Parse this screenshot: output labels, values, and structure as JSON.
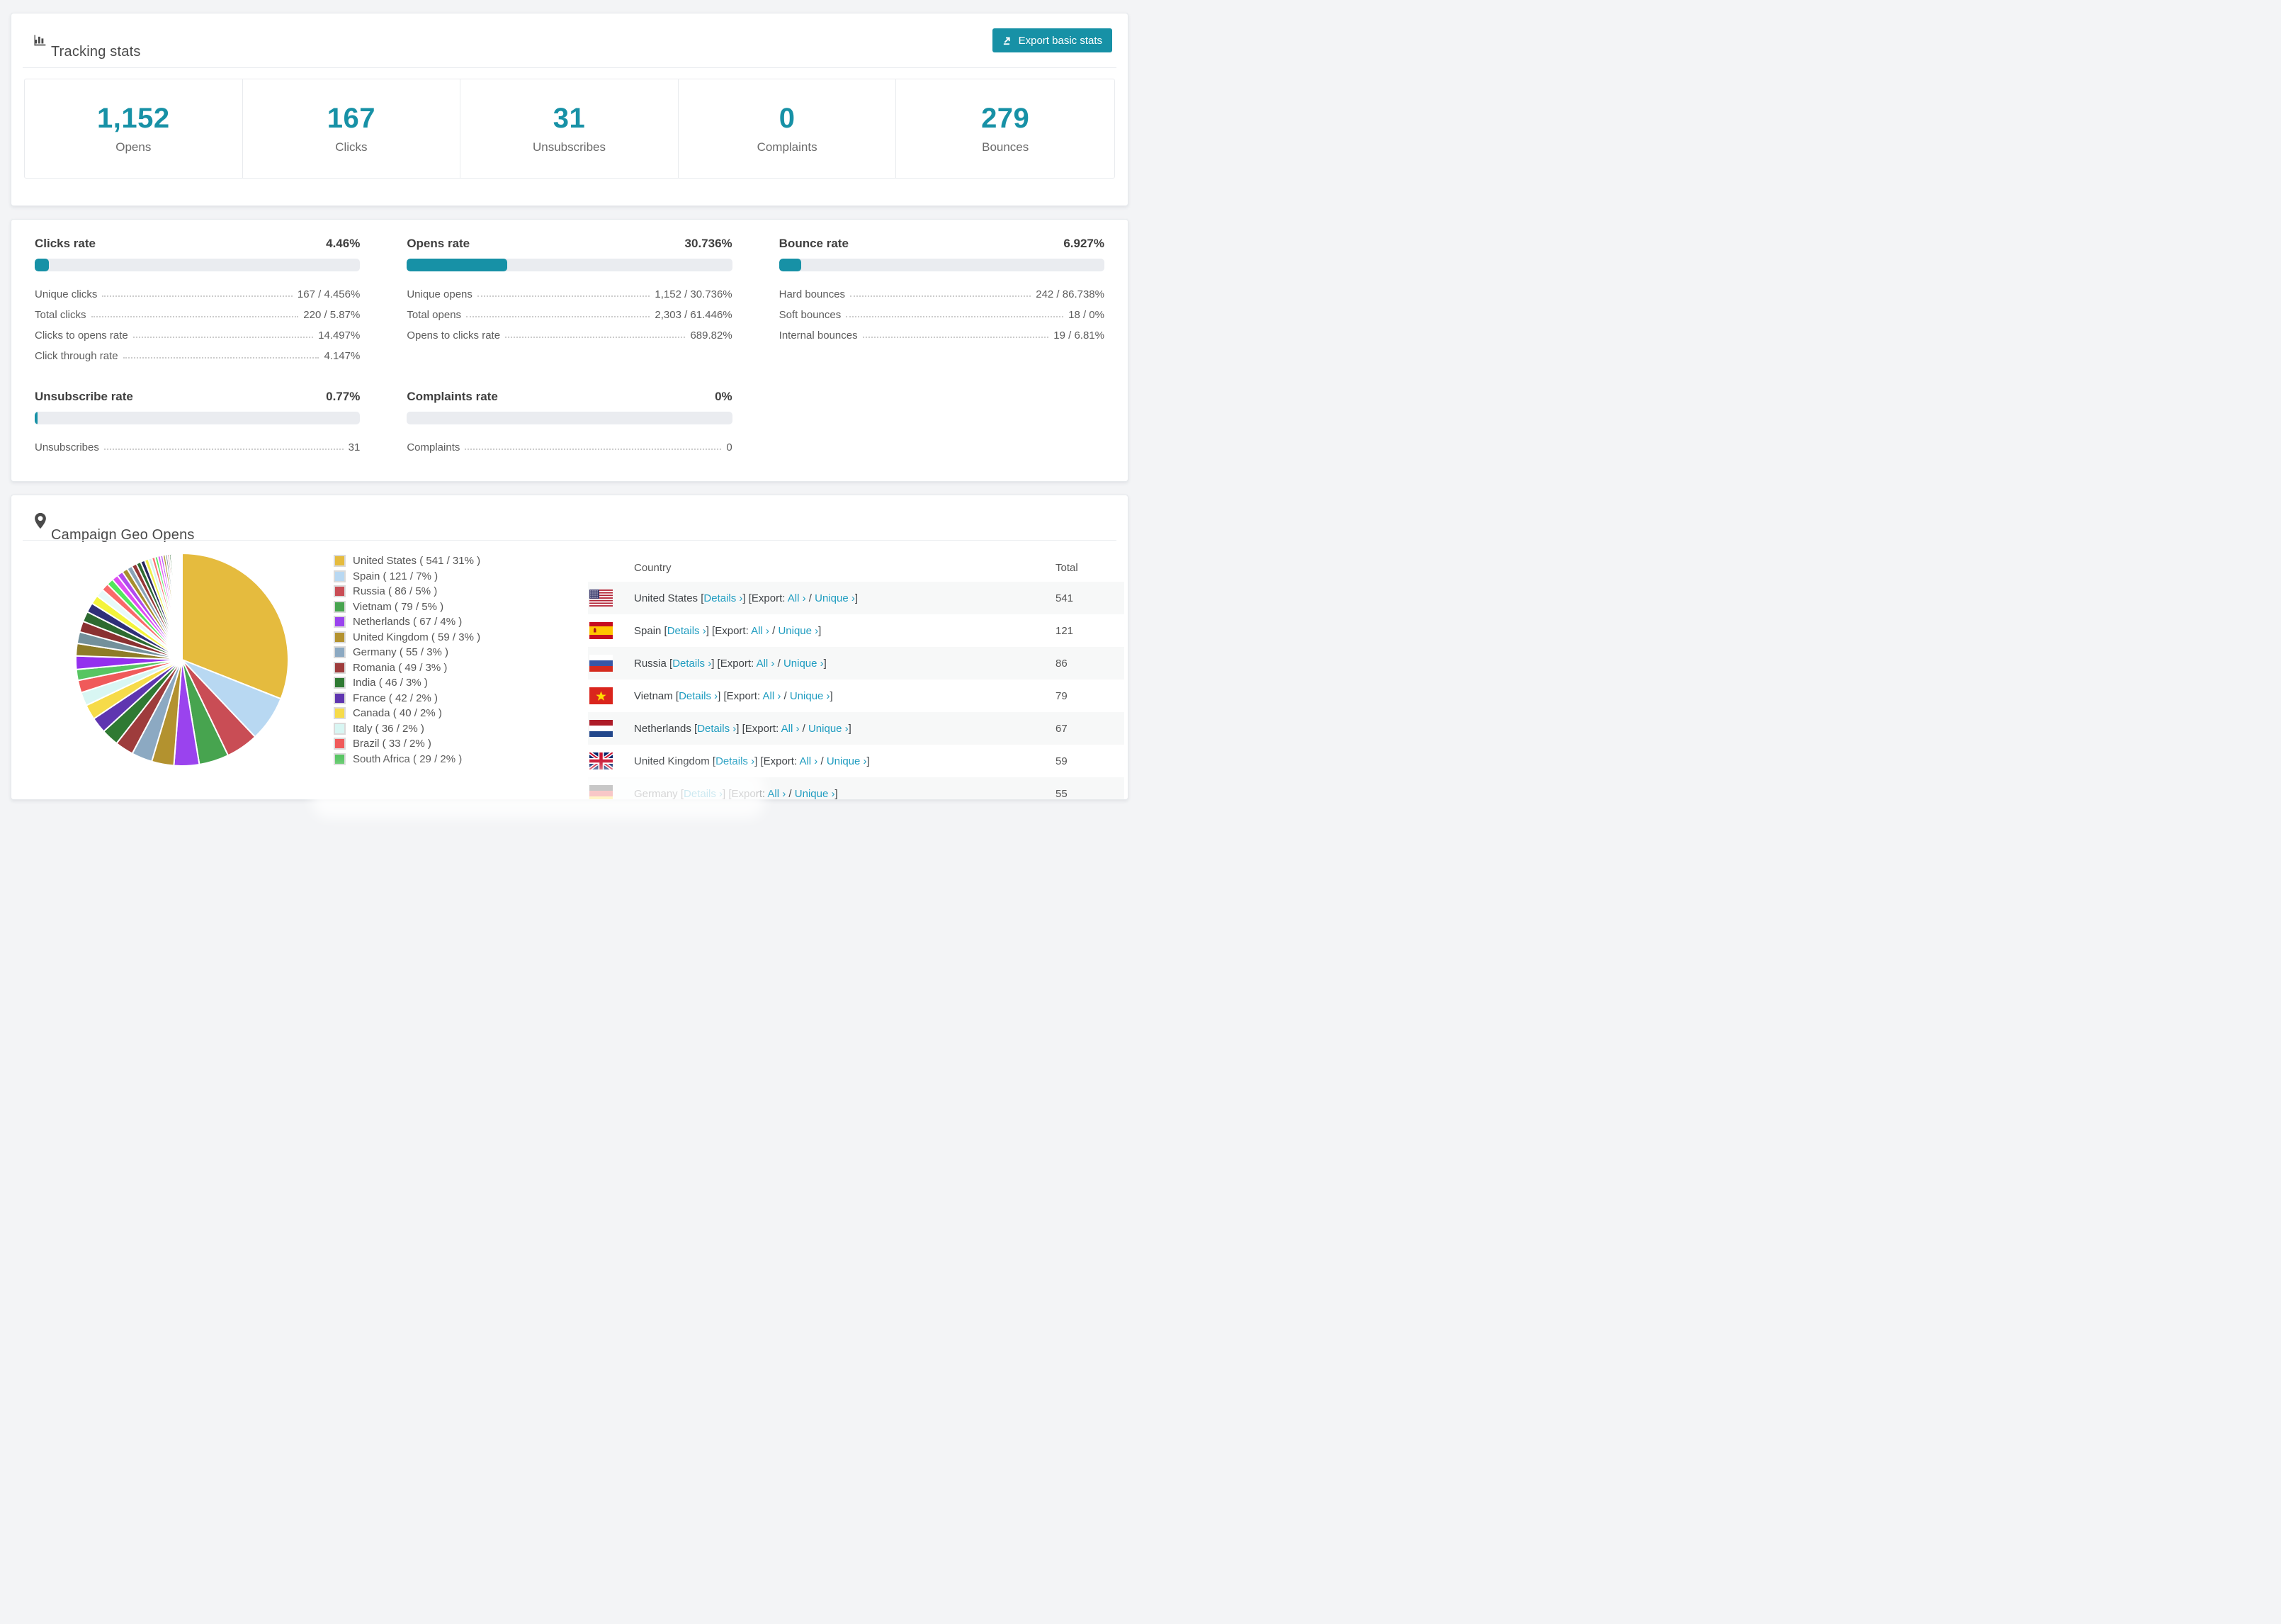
{
  "page": {
    "accent": "#1791a6",
    "link_color": "#1f9cc0",
    "background": "#f3f4f6"
  },
  "tracking": {
    "title": "Tracking stats",
    "export_button": "Export basic stats",
    "summary": [
      {
        "value": "1,152",
        "label": "Opens"
      },
      {
        "value": "167",
        "label": "Clicks"
      },
      {
        "value": "31",
        "label": "Unsubscribes"
      },
      {
        "value": "0",
        "label": "Complaints"
      },
      {
        "value": "279",
        "label": "Bounces"
      }
    ]
  },
  "rates": {
    "blocks": [
      {
        "title": "Clicks rate",
        "percent": "4.46%",
        "bar": 4.46,
        "rows": [
          {
            "label": "Unique clicks",
            "value": "167 / 4.456%"
          },
          {
            "label": "Total clicks",
            "value": "220 / 5.87%"
          },
          {
            "label": "Clicks to opens rate",
            "value": "14.497%"
          },
          {
            "label": "Click through rate",
            "value": "4.147%"
          }
        ]
      },
      {
        "title": "Opens rate",
        "percent": "30.736%",
        "bar": 30.736,
        "rows": [
          {
            "label": "Unique opens",
            "value": "1,152 / 30.736%"
          },
          {
            "label": "Total opens",
            "value": "2,303 / 61.446%"
          },
          {
            "label": "Opens to clicks rate",
            "value": "689.82%"
          }
        ]
      },
      {
        "title": "Bounce rate",
        "percent": "6.927%",
        "bar": 6.927,
        "rows": [
          {
            "label": "Hard bounces",
            "value": "242 / 86.738%"
          },
          {
            "label": "Soft bounces",
            "value": "18 / 0%"
          },
          {
            "label": "Internal bounces",
            "value": "19 / 6.81%"
          }
        ]
      },
      {
        "title": "Unsubscribe rate",
        "percent": "0.77%",
        "bar": 0.77,
        "rows": [
          {
            "label": "Unsubscribes",
            "value": "31"
          }
        ]
      },
      {
        "title": "Complaints rate",
        "percent": "0%",
        "bar": 0,
        "rows": [
          {
            "label": "Complaints",
            "value": "0"
          }
        ]
      }
    ],
    "column_layout": [
      [
        0,
        3
      ],
      [
        1,
        4
      ],
      [
        2
      ]
    ]
  },
  "geo": {
    "title": "Campaign Geo Opens",
    "table": {
      "columns": [
        "Country",
        "Total"
      ],
      "link": {
        "details": "Details ›",
        "export_prefix": "Export:",
        "all": "All ›",
        "unique": "Unique ›"
      },
      "rows": [
        {
          "flag": "us",
          "country": "United States",
          "total": "541"
        },
        {
          "flag": "es",
          "country": "Spain",
          "total": "121"
        },
        {
          "flag": "ru",
          "country": "Russia",
          "total": "86"
        },
        {
          "flag": "vn",
          "country": "Vietnam",
          "total": "79"
        },
        {
          "flag": "nl",
          "country": "Netherlands",
          "total": "67"
        },
        {
          "flag": "gb",
          "country": "United Kingdom",
          "total": "59"
        },
        {
          "flag": "de",
          "country": "Germany",
          "total": "55"
        }
      ]
    }
  },
  "chart_data": {
    "type": "pie",
    "title": "Campaign Geo Opens",
    "legend_position": "right",
    "start": "top",
    "clockwise": true,
    "slices": [
      {
        "label": "United States",
        "value": 541,
        "pct": 31,
        "color": "#e5bb3e"
      },
      {
        "label": "Spain",
        "value": 121,
        "pct": 7,
        "color": "#b8d8f2"
      },
      {
        "label": "Russia",
        "value": 86,
        "pct": 5,
        "color": "#c94d55"
      },
      {
        "label": "Vietnam",
        "value": 79,
        "pct": 5,
        "color": "#47a44f"
      },
      {
        "label": "Netherlands",
        "value": 67,
        "pct": 4,
        "color": "#9a43ee"
      },
      {
        "label": "United Kingdom",
        "value": 59,
        "pct": 3,
        "color": "#b3922f"
      },
      {
        "label": "Germany",
        "value": 55,
        "pct": 3,
        "color": "#8ca9c2"
      },
      {
        "label": "Romania",
        "value": 49,
        "pct": 3,
        "color": "#9e3c3c"
      },
      {
        "label": "India",
        "value": 46,
        "pct": 3,
        "color": "#2f7a33"
      },
      {
        "label": "France",
        "value": 42,
        "pct": 2,
        "color": "#5f35b0"
      },
      {
        "label": "Canada",
        "value": 40,
        "pct": 2,
        "color": "#f6db49"
      },
      {
        "label": "Italy",
        "value": 36,
        "pct": 2,
        "color": "#d8f6f3"
      },
      {
        "label": "Brazil",
        "value": 33,
        "pct": 2,
        "color": "#f05a5a"
      },
      {
        "label": "South Africa",
        "value": 29,
        "pct": 2,
        "color": "#57c562"
      }
    ],
    "other_unlabeled": {
      "total_value": 462,
      "weights": [
        38,
        35,
        33,
        31,
        29,
        27,
        25,
        23,
        21,
        19,
        18,
        17,
        16,
        15,
        14,
        13,
        12,
        11,
        10,
        9,
        8,
        8,
        7,
        7,
        6,
        5,
        5,
        4,
        4,
        3,
        3,
        3,
        2,
        2,
        2,
        2,
        2,
        2,
        1,
        1
      ],
      "colors": [
        "#9330ee",
        "#8e7c27",
        "#73909b",
        "#8a3131",
        "#2d6a30",
        "#2f2f78",
        "#f4f43b",
        "#e8faf9",
        "#f96a6a",
        "#53e75d",
        "#df4ef2",
        "#b24aef",
        "#a78f2d",
        "#8aa3b7",
        "#953838",
        "#2f6a33",
        "#28285d",
        "#efef4a",
        "#d5f4f0",
        "#f97070",
        "#5de766",
        "#e75ef2",
        "#bb5af5",
        "#af9a33",
        "#6f8899",
        "#9f3a3a",
        "#2b6a2f",
        "#32327a",
        "#f6f63a",
        "#effaf9",
        "#f46a6a",
        "#56e75e",
        "#dc4ef0",
        "#ae4af1",
        "#9f892b",
        "#7d92a5",
        "#8a3434",
        "#2d6a31",
        "#2e2e77",
        "#f4f449"
      ]
    }
  }
}
